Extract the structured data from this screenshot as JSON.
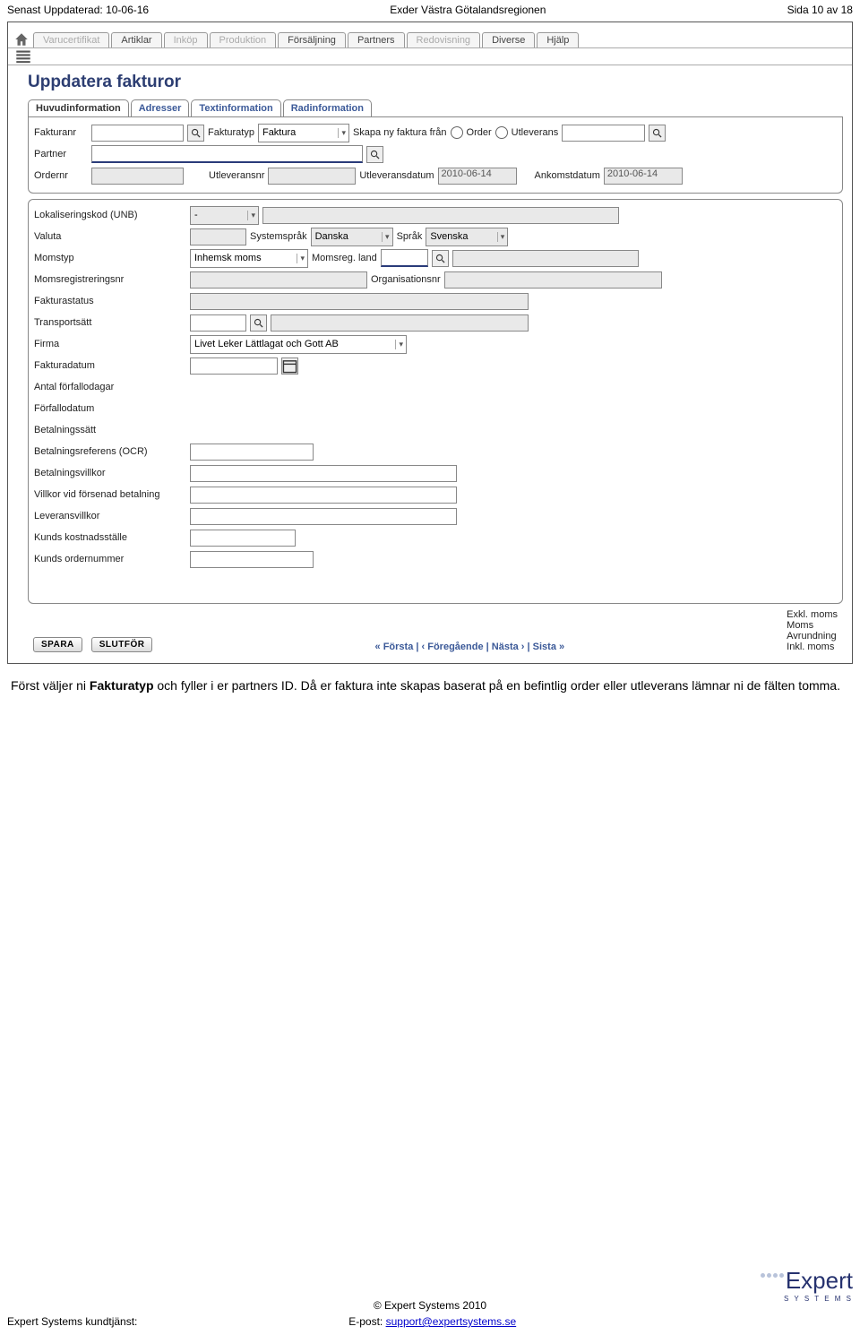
{
  "header": {
    "left": "Senast Uppdaterad: 10-06-16",
    "center": "Exder Västra Götalandsregionen",
    "right": "Sida 10 av 18"
  },
  "menuTabs": [
    "Varucertifikat",
    "Artiklar",
    "Inköp",
    "Produktion",
    "Försäljning",
    "Partners",
    "Redovisning",
    "Diverse",
    "Hjälp"
  ],
  "dimIndexes": [
    0,
    2,
    3,
    6
  ],
  "pageTitle": "Uppdatera fakturor",
  "subTabs": [
    "Huvudinformation",
    "Adresser",
    "Textinformation",
    "Radinformation"
  ],
  "top": {
    "fakturanrLabel": "Fakturanr",
    "fakturatypLabel": "Fakturatyp",
    "fakturatypValue": "Faktura",
    "skapaLabel": "Skapa ny faktura från",
    "orderLabel": "Order",
    "utlevLabel": "Utleverans",
    "partnerLabel": "Partner",
    "ordernrLabel": "Ordernr",
    "utleveransnrLabel": "Utleveransnr",
    "utleveransdatumLabel": "Utleveransdatum",
    "utleveransdatumValue": "2010-06-14",
    "ankomstdatumLabel": "Ankomstdatum",
    "ankomstdatumValue": "2010-06-14"
  },
  "form": {
    "lokaliseringLabel": "Lokaliseringskod (UNB)",
    "lokaliseringValue": "-",
    "valutaLabel": "Valuta",
    "systemsprakLabel": "Systemspråk",
    "systemsprakValue": "Danska",
    "sprakLabel": "Språk",
    "sprakValue": "Svenska",
    "momstypLabel": "Momstyp",
    "momstypValue": "Inhemsk moms",
    "momsregLandLabel": "Momsreg. land",
    "momsregnrLabel": "Momsregistreringsnr",
    "orgnrLabel": "Organisationsnr",
    "fakturastatusLabel": "Fakturastatus",
    "transportLabel": "Transportsätt",
    "firmaLabel": "Firma",
    "firmaValue": "Livet Leker Lättlagat och Gott AB",
    "fakturadatumLabel": "Fakturadatum",
    "antalForfLabel": "Antal förfallodagar",
    "forfallodatumLabel": "Förfallodatum",
    "betalsattLabel": "Betalningssätt",
    "ocrLabel": "Betalningsreferens (OCR)",
    "betalvillkorLabel": "Betalningsvillkor",
    "forsenadLabel": "Villkor vid försenad betalning",
    "leveransvillkorLabel": "Leveransvillkor",
    "kostnadsstalleLabel": "Kunds kostnadsställe",
    "kundOrdernrLabel": "Kunds ordernummer"
  },
  "footerBar": {
    "spara": "SPARA",
    "slutfor": "SLUTFÖR",
    "pager": "«  Första  |  ‹  Föregående  |  Nästa  ›  |  Sista  »",
    "totals": [
      "Exkl. moms",
      "Moms",
      "Avrundning",
      "Inkl. moms"
    ]
  },
  "explainLine1a": "Först väljer ni ",
  "explainBold": "Fakturatyp",
  "explainLine1b": " och fyller i er partners ID. Då er faktura inte skapas baserat på en befintlig order eller utleverans lämnar ni de fälten tomma.",
  "pageFooter": {
    "copyright": "© Expert Systems 2010",
    "leftLabel": "Expert Systems kundtjänst:",
    "emailLabel": "E-post: ",
    "email": "support@expertsystems.se"
  },
  "logo": {
    "text": "Expert",
    "sub": "S Y S T E M S"
  }
}
